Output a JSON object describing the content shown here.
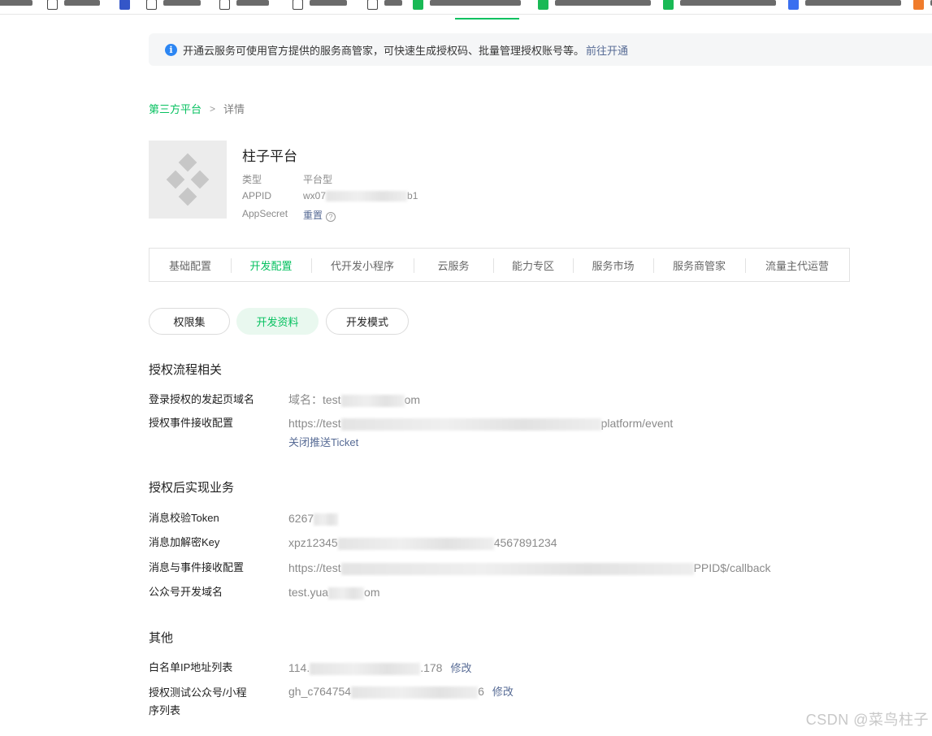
{
  "notice": {
    "text": "开通云服务可使用官方提供的服务商管家，可快速生成授权码、批量管理授权账号等。",
    "link": "前往开通"
  },
  "breadcrumb": {
    "parent": "第三方平台",
    "current": "详情"
  },
  "app": {
    "name": "柱子平台",
    "type_label": "类型",
    "type_value": "平台型",
    "appid_label": "APPID",
    "appid_prefix": "wx07",
    "appid_suffix": "b1",
    "secret_label": "AppSecret",
    "secret_action": "重置"
  },
  "tabs": [
    "基础配置",
    "开发配置",
    "代开发小程序",
    "云服务",
    "能力专区",
    "服务市场",
    "服务商管家",
    "流量主代运营"
  ],
  "active_tab": "开发配置",
  "pills": [
    "权限集",
    "开发资料",
    "开发模式"
  ],
  "active_pill": "开发资料",
  "auth_flow": {
    "title": "授权流程相关",
    "login_domain_label": "登录授权的发起页域名",
    "login_domain_prefix": "域名：test",
    "login_domain_suffix": "om",
    "event_label": "授权事件接收配置",
    "event_prefix": "https://test",
    "event_suffix": "platform/event",
    "close_ticket": "关闭推送Ticket"
  },
  "business": {
    "title": "授权后实现业务",
    "token_label": "消息校验Token",
    "token_prefix": "6267",
    "key_label": "消息加解密Key",
    "key_prefix": "xpz12345",
    "key_suffix": "4567891234",
    "callback_label": "消息与事件接收配置",
    "callback_prefix": "https://test",
    "callback_suffix": "PPID$/callback",
    "domain_label": "公众号开发域名",
    "domain_prefix": "test.yua",
    "domain_suffix": "om"
  },
  "other": {
    "title": "其他",
    "ip_label": "白名单IP地址列表",
    "ip_prefix": "114.",
    "ip_suffix": ".178",
    "ip_action": "修改",
    "test_label_1": "授权测试公众号/小程",
    "test_label_2": "序列表",
    "test_prefix": "gh_c764754",
    "test_suffix": "6",
    "test_action": "修改"
  },
  "watermark": "CSDN @菜鸟柱子",
  "colors": {
    "accent": "#07c160",
    "link": "#576b95",
    "info": "#2c86f3"
  }
}
